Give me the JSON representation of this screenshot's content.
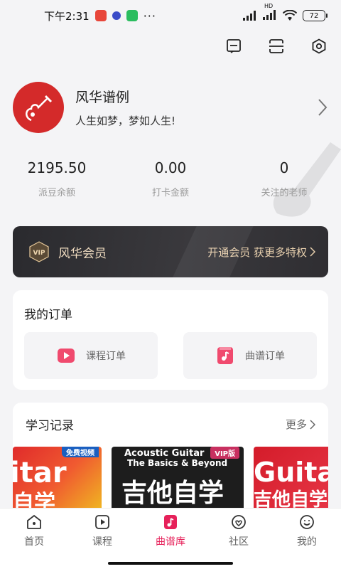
{
  "status": {
    "time": "下午2:31",
    "network": "HD",
    "battery": "72"
  },
  "profile": {
    "name": "风华谱例",
    "motto": "人生如梦，梦如人生!"
  },
  "stats": [
    {
      "value": "2195.50",
      "label": "派豆余额"
    },
    {
      "value": "0.00",
      "label": "打卡金额"
    },
    {
      "value": "0",
      "label": "关注的老师"
    }
  ],
  "vip": {
    "badge": "VIP",
    "title": "风华会员",
    "cta": "开通会员 获更多特权"
  },
  "orders": {
    "title": "我的订单",
    "course_order": "课程订单",
    "score_order": "曲谱订单"
  },
  "records": {
    "title": "学习记录",
    "more": "更多",
    "books": [
      {
        "tag": "免费视频",
        "title": "itar",
        "sub": "自学"
      },
      {
        "tag": "VIP版",
        "title_en_1": "Acoustic Guitar",
        "title_en_2": "The Basics & Beyond",
        "title": "吉他自学"
      },
      {
        "title": "Guitar",
        "sub": "吉他自学"
      }
    ]
  },
  "tabs": [
    {
      "label": "首页",
      "icon": "home-icon"
    },
    {
      "label": "课程",
      "icon": "play-icon"
    },
    {
      "label": "曲谱库",
      "icon": "music-library-icon"
    },
    {
      "label": "社区",
      "icon": "community-icon"
    },
    {
      "label": "我的",
      "icon": "profile-icon"
    }
  ],
  "colors": {
    "accent": "#e6215a",
    "avatar": "#d42a2a",
    "vip_bg": "#2f2e32",
    "vip_text": "#e8d0ae"
  }
}
